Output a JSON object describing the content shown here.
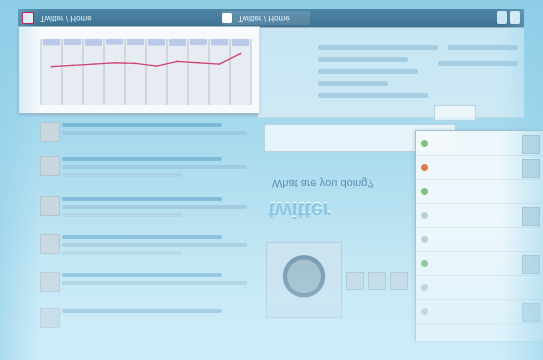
{
  "taskbar": {
    "task_1": "Twitter / Home",
    "task_2": "Twitter / Home"
  },
  "main": {
    "question": "What are you doing?",
    "logo": "twitter"
  },
  "chart_data": {
    "type": "line",
    "categories": [
      "",
      "",
      "",
      "",
      "",
      "",
      "",
      "",
      "",
      ""
    ],
    "series": [
      {
        "values": [
          58,
          60,
          62,
          64,
          63,
          59,
          66,
          64,
          62,
          78
        ]
      }
    ],
    "bars": [
      32,
      30,
      34,
      28,
      31,
      33,
      35,
      30,
      32,
      36
    ],
    "ylim": [
      0,
      100
    ],
    "colors": {
      "line": "#d04070",
      "bar": "#b9c9e8",
      "grid": "#9fb1bf"
    }
  },
  "side_panel": {
    "items": [
      "",
      "",
      "",
      "",
      "",
      "",
      "",
      ""
    ]
  },
  "colors": {
    "accent": "#4b8ab1",
    "taskbar": "#3e7192",
    "background": "#a9dbee"
  }
}
